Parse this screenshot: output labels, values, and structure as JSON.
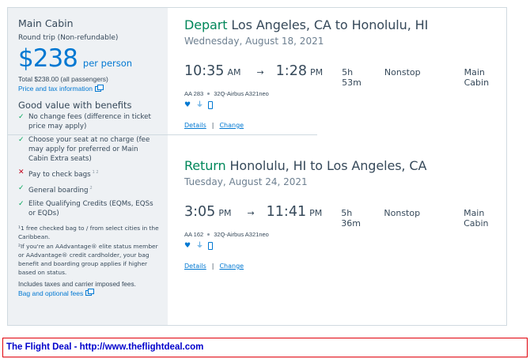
{
  "fare": {
    "cabin": "Main Cabin",
    "trip_type": "Round trip (Non-refundable)",
    "price": "$238",
    "per_person": "per person",
    "total": "Total $238.00 (all passengers)",
    "price_tax_link": "Price and tax information",
    "good_value_heading": "Good value with benefits",
    "benefits": [
      {
        "icon": "check-icon",
        "text": "No change fees (difference in ticket price may apply)",
        "sup": ""
      },
      {
        "icon": "check-icon",
        "text": "Choose your seat at no charge (fee may apply for preferred or Main Cabin Extra seats)",
        "sup": ""
      },
      {
        "icon": "cross-icon",
        "text": "Pay to check bags",
        "sup": "1 2"
      },
      {
        "icon": "check-icon",
        "text": "General boarding",
        "sup": "2"
      },
      {
        "icon": "check-icon",
        "text": "Elite Qualifying Credits (EQMs, EQSs or EQDs)",
        "sup": ""
      }
    ],
    "footnote_1": "¹1 free checked bag to / from select cities in the Caribbean.",
    "footnote_2": "²If you're an AAdvantage® elite status member or AAdvantage® credit cardholder, your bag benefit and boarding group applies if higher based on status.",
    "taxes_note": "Includes taxes and carrier imposed fees.",
    "bag_fees_link": "Bag and optional fees"
  },
  "segments": [
    {
      "direction": "Depart",
      "route": "Los Angeles, CA to Honolulu, HI",
      "date": "Wednesday, August 18, 2021",
      "depart_time": "10:35",
      "depart_ampm": "AM",
      "arrive_time": "1:28",
      "arrive_ampm": "PM",
      "duration": "5h 53m",
      "stops": "Nonstop",
      "cabin": "Main Cabin",
      "flight_no": "AA 283",
      "aircraft": "32Q-Airbus A321neo",
      "details": "Details",
      "change": "Change",
      "separator": "|"
    },
    {
      "direction": "Return",
      "route": "Honolulu, HI to Los Angeles, CA",
      "date": "Tuesday, August 24, 2021",
      "depart_time": "3:05",
      "depart_ampm": "PM",
      "arrive_time": "11:41",
      "arrive_ampm": "PM",
      "duration": "5h 36m",
      "stops": "Nonstop",
      "cabin": "Main Cabin",
      "flight_no": "AA 162",
      "aircraft": "32Q-Airbus A321neo",
      "details": "Details",
      "change": "Change",
      "separator": "|"
    }
  ],
  "footer": {
    "deal_text": "The Flight Deal - http://www.theflightdeal.com"
  },
  "colors": {
    "accent": "#0078d2",
    "direction": "#00875a",
    "check": "#00a65a",
    "cross": "#c30019",
    "sidebar_bg": "#eef1f4",
    "deal_border": "#e0000a",
    "deal_text": "#0000cc"
  }
}
